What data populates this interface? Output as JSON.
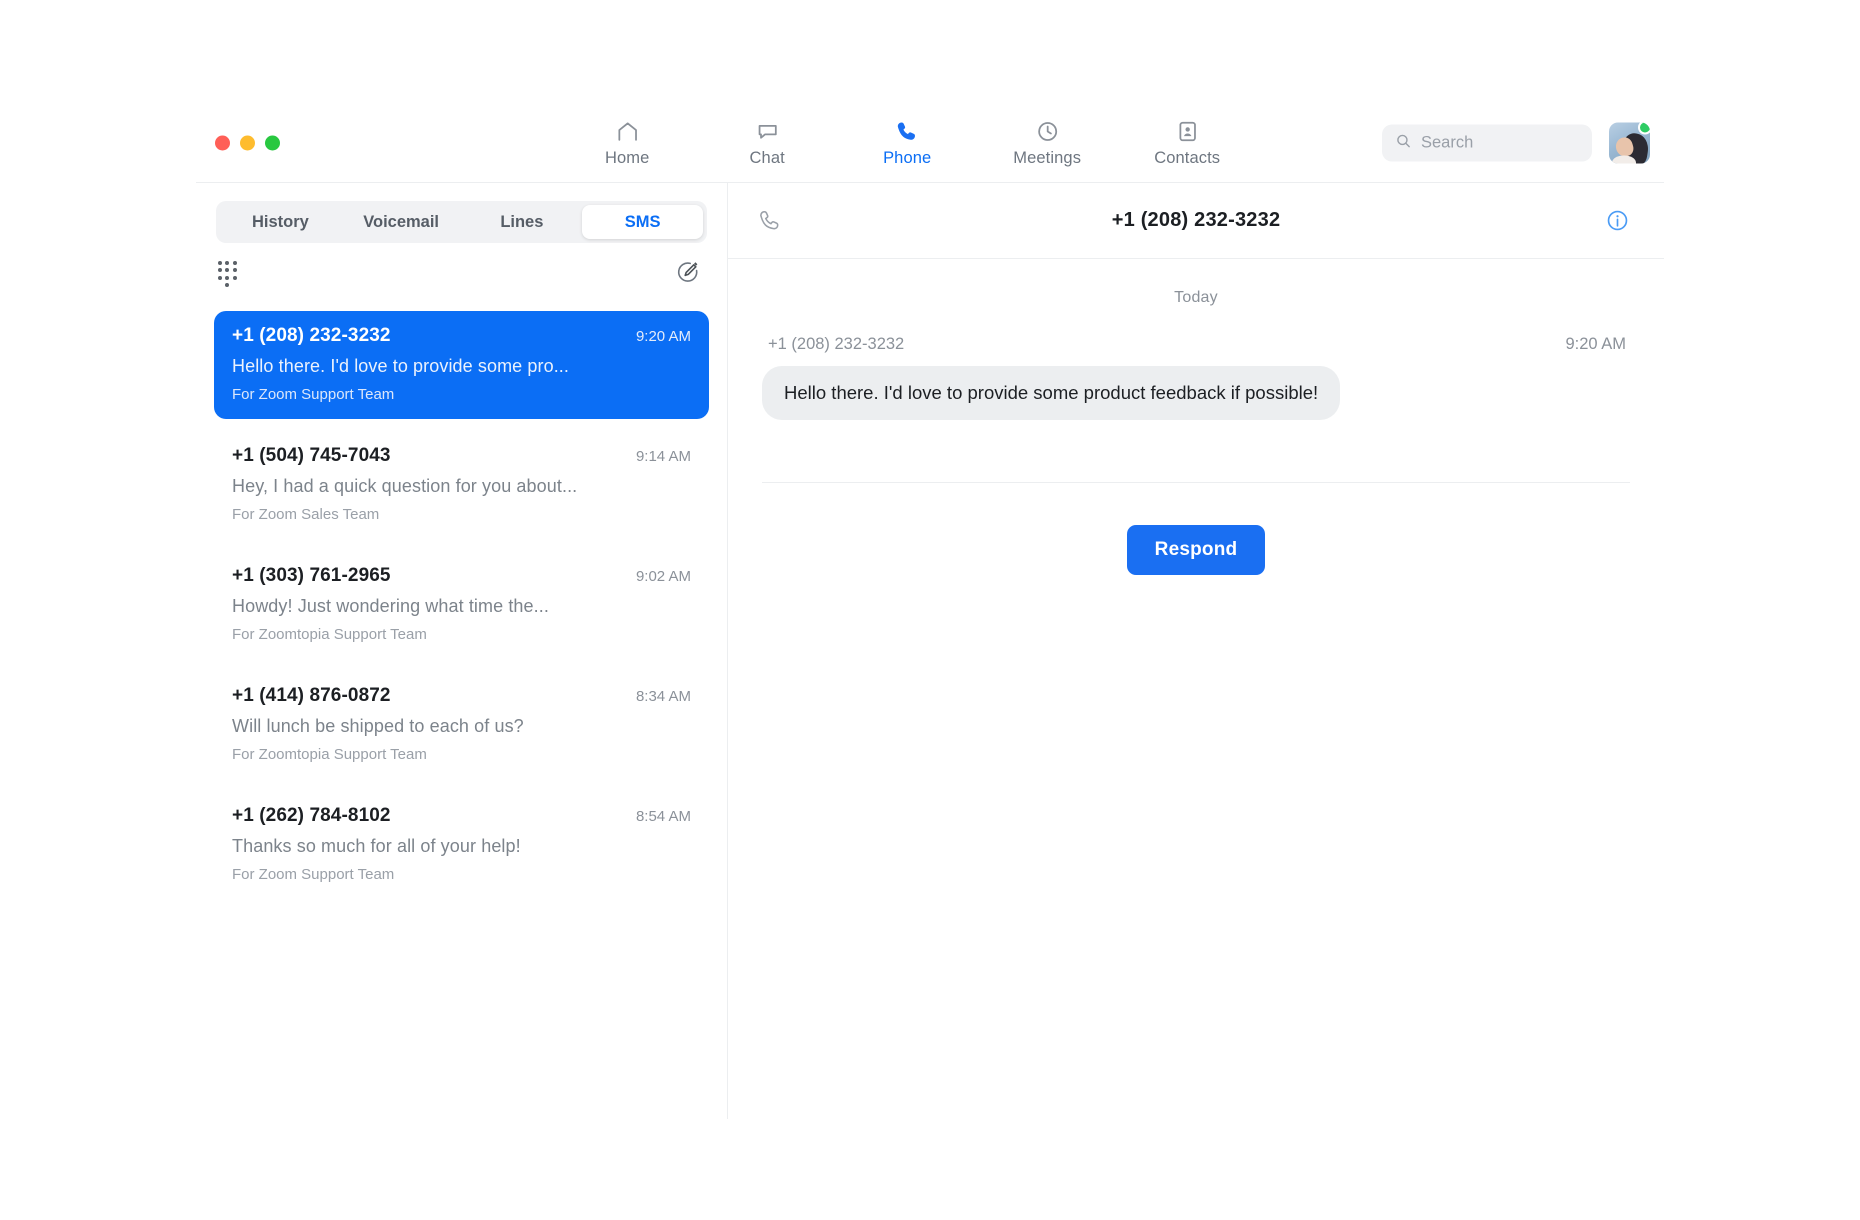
{
  "window": {
    "traffic_lights": {
      "close_color": "#ff5f57",
      "minimize_color": "#febc2e",
      "maximize_color": "#28c840"
    }
  },
  "theme": {
    "accent": "#0b6ef5",
    "accent_button": "#1a6ff2",
    "muted_text": "#8b9199",
    "bubble_bg": "#eceef0",
    "online_badge": "#2ecc63"
  },
  "topnav": {
    "items": [
      {
        "label": "Home",
        "icon": "home-icon",
        "active": false
      },
      {
        "label": "Chat",
        "icon": "chat-bubble-icon",
        "active": false
      },
      {
        "label": "Phone",
        "icon": "phone-handset-icon",
        "active": true
      },
      {
        "label": "Meetings",
        "icon": "clock-icon",
        "active": false
      },
      {
        "label": "Contacts",
        "icon": "contact-card-icon",
        "active": false
      }
    ]
  },
  "search": {
    "placeholder": "Search",
    "value": "",
    "icon": "search-icon"
  },
  "profile": {
    "avatar_icon": "avatar",
    "status": "available"
  },
  "left_panel": {
    "tabs": [
      {
        "label": "History",
        "active": false
      },
      {
        "label": "Voicemail",
        "active": false
      },
      {
        "label": "Lines",
        "active": false
      },
      {
        "label": "SMS",
        "active": true
      }
    ],
    "actions": {
      "dialpad_icon": "dialpad-icon",
      "compose_icon": "compose-pencil-icon"
    },
    "conversations": [
      {
        "number": "+1 (208) 232-3232",
        "time": "9:20 AM",
        "preview": "Hello there. I'd love to provide some pro...",
        "line": "For Zoom Support Team",
        "selected": true
      },
      {
        "number": "+1 (504) 745-7043",
        "time": "9:14 AM",
        "preview": "Hey, I had a quick question for you about...",
        "line": "For Zoom Sales Team",
        "selected": false
      },
      {
        "number": "+1 (303) 761-2965",
        "time": "9:02 AM",
        "preview": "Howdy! Just wondering what time the...",
        "line": "For Zoomtopia Support Team",
        "selected": false
      },
      {
        "number": "+1 (414) 876-0872",
        "time": "8:34 AM",
        "preview": "Will lunch be shipped to each of us?",
        "line": "For Zoomtopia Support Team",
        "selected": false
      },
      {
        "number": "+1 (262) 784-8102",
        "time": "8:54 AM",
        "preview": "Thanks so much for all of your help!",
        "line": "For Zoom Support Team",
        "selected": false
      }
    ]
  },
  "thread": {
    "title": "+1 (208) 232-3232",
    "call_icon": "phone-handset-icon",
    "info_icon": "info-circle-icon",
    "day_divider": "Today",
    "messages": [
      {
        "sender": "+1 (208) 232-3232",
        "time": "9:20 AM",
        "text": "Hello there. I'd love to provide some product feedback if possible!",
        "direction": "incoming"
      }
    ],
    "respond_label": "Respond"
  }
}
